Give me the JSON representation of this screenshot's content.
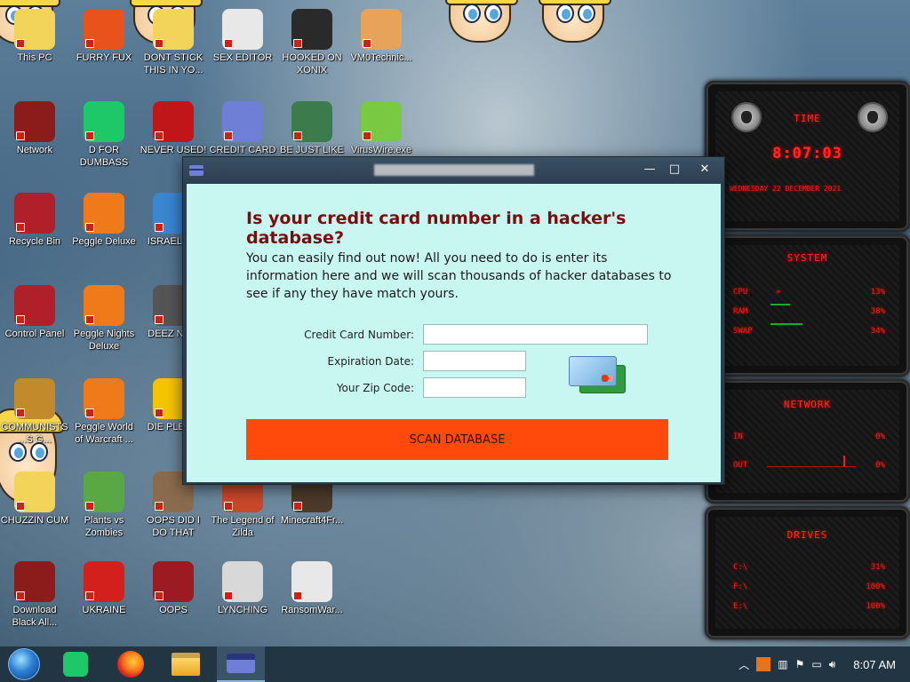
{
  "desktop": {
    "icons": [
      {
        "label": "This PC",
        "icon": "this-pc-icon",
        "color": "#f2d45a"
      },
      {
        "label": "FURRY FUX",
        "icon": "firefox-style-icon",
        "color": "#e8531c"
      },
      {
        "label": "DONT STICK THIS IN YO...",
        "icon": "cartoon-face-icon",
        "color": "#f2d45a"
      },
      {
        "label": "SEX EDITOR",
        "icon": "hxd-editor-icon",
        "color": "#e8e8e8"
      },
      {
        "label": "HOOKED ON XONIX",
        "icon": "xonix-game-icon",
        "color": "#2a2a2a"
      },
      {
        "label": "VM0Technic...",
        "icon": "doctor-icon",
        "color": "#e8a35a"
      },
      {
        "label": "Network",
        "icon": "network-orb-icon",
        "color": "#8a1c1c"
      },
      {
        "label": "D FOR DUMBASS",
        "icon": "green-app-icon",
        "color": "#1ec869"
      },
      {
        "label": "NEVER USED!",
        "icon": "dev-cpp-icon",
        "color": "#c0161a"
      },
      {
        "label": "CREDIT CARD CHECKER",
        "icon": "credit-card-icon",
        "color": "#6f7fd6"
      },
      {
        "label": "BE JUST LIKE THE DUDE!",
        "icon": "elf-icon",
        "color": "#3c7c4c"
      },
      {
        "label": "VirusWire.exe",
        "icon": "lime-icon",
        "color": "#7ac943"
      },
      {
        "label": "Recycle Bin",
        "icon": "recycle-bin-icon",
        "color": "#b0202a"
      },
      {
        "label": "Peggle Deluxe",
        "icon": "peggle-icon",
        "color": "#f07a1a"
      },
      {
        "label": "ISRAEL S...",
        "icon": "israel-icon",
        "color": "#3a86d1"
      },
      {
        "label": "Control Panel",
        "icon": "control-panel-icon",
        "color": "#b0202a"
      },
      {
        "label": "Peggle Nights Deluxe",
        "icon": "peggle-nights-icon",
        "color": "#f07a1a"
      },
      {
        "label": "DEEZ NU...",
        "icon": "stacked-windows-icon",
        "color": "#555555"
      },
      {
        "label": "COMMUNISTS ...S G...",
        "icon": "money-bag-icon",
        "color": "#c28a2a"
      },
      {
        "label": "Peggle World of Warcraft ...",
        "icon": "peggle-wow-icon",
        "color": "#f07a1a"
      },
      {
        "label": "DIE PLEA...",
        "icon": "die-icon",
        "color": "#f5c400"
      },
      {
        "label": "CHUZZIN CUM",
        "icon": "chuzzle-icon",
        "color": "#f2d45a"
      },
      {
        "label": "Plants vs Zombies",
        "icon": "plant-icon",
        "color": "#5aa843"
      },
      {
        "label": "OOPS DID I DO THAT",
        "icon": "portrait-icon",
        "color": "#8a6b4d"
      },
      {
        "label": "The Legend of Zilda",
        "icon": "zilda-sprite-icon",
        "color": "#c8482b"
      },
      {
        "label": "Minecraft4Fr...",
        "icon": "minecraft-icon",
        "color": "#4c3a2a"
      },
      {
        "label": "Download Black All...",
        "icon": "black-orb-icon",
        "color": "#8a1c1c"
      },
      {
        "label": "UKRAINE",
        "icon": "radiation-icon",
        "color": "#d4201c"
      },
      {
        "label": "OOPS",
        "icon": "red-tile-icon",
        "color": "#9c1a22"
      },
      {
        "label": "LYNCHING",
        "icon": "noose-icon",
        "color": "#d8d8d8"
      },
      {
        "label": "RansomWar...",
        "icon": "skull-icon",
        "color": "#e8e8e8"
      }
    ]
  },
  "dialog": {
    "heading": "Is your credit card number in a hacker's database?",
    "description": "You can easily find out now! All you need to do is enter its information here and we will scan thousands of hacker databases to see if any they have match yours.",
    "fields": {
      "card_number_label": "Credit Card Number:",
      "card_number_value": "",
      "expiration_label": "Expiration Date:",
      "expiration_value": "",
      "zip_label": "Your Zip Code:",
      "zip_value": ""
    },
    "scan_button": "SCAN DATABASE",
    "controls": {
      "minimize": "—",
      "maximize": "□",
      "close": "✕"
    }
  },
  "gadget": {
    "time_title": "TIME",
    "time_value": "8:07:03",
    "date_value": "WEDNESDAY 22 DECEMBER 2021",
    "system_title": "SYSTEM",
    "cpu_label": "CPU",
    "cpu_value": "13%",
    "ram_label": "RAM",
    "ram_value": "38%",
    "swap_label": "SWAP",
    "swap_value": "34%",
    "network_title": "NETWORK",
    "in_label": "IN",
    "in_value": "0%",
    "out_label": "OUT",
    "out_value": "0%",
    "drives_title": "DRIVES",
    "drives": [
      {
        "label": "C:\\",
        "value": "31%"
      },
      {
        "label": "F:\\",
        "value": "100%"
      },
      {
        "label": "E:\\",
        "value": "100%"
      }
    ]
  },
  "taskbar": {
    "clock": "8:07 AM",
    "pinned": [
      "green-app-icon",
      "firefox-icon",
      "file-explorer-icon",
      "credit-card-icon"
    ]
  },
  "colors": {
    "dialog_bg": "#c8f7f2",
    "heading": "#7a0e0e",
    "scan_button": "#ff4a0c",
    "taskbar": "#223543",
    "gadget_accent": "#ff2a1f"
  }
}
